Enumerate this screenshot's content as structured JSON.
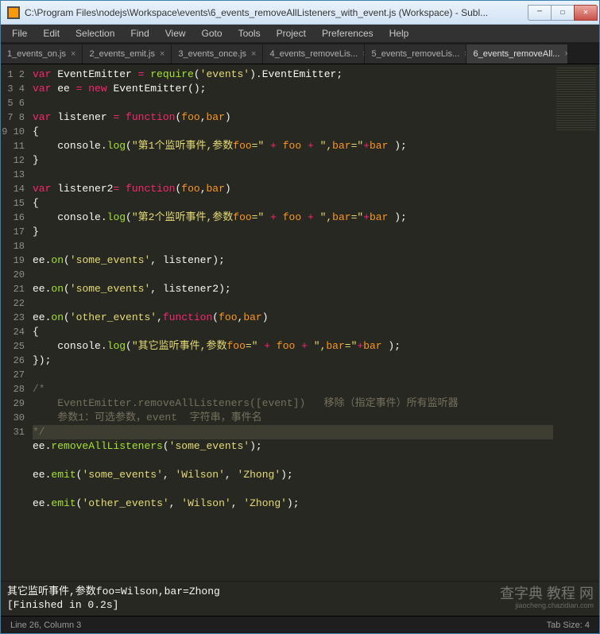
{
  "window": {
    "title": "C:\\Program Files\\nodejs\\Workspace\\events\\6_events_removeAllListeners_with_event.js (Workspace) - Subl..."
  },
  "menu": {
    "items": [
      "File",
      "Edit",
      "Selection",
      "Find",
      "View",
      "Goto",
      "Tools",
      "Project",
      "Preferences",
      "Help"
    ]
  },
  "tabs": [
    {
      "label": "1_events_on.js",
      "active": false
    },
    {
      "label": "2_events_emit.js",
      "active": false
    },
    {
      "label": "3_events_once.js",
      "active": false
    },
    {
      "label": "4_events_removeLis...",
      "active": false
    },
    {
      "label": "5_events_removeLis...",
      "active": false
    },
    {
      "label": "6_events_removeAll...",
      "active": true
    }
  ],
  "code": {
    "lines": [
      {
        "n": 1,
        "t": "var",
        "raw": "var EventEmitter = require('events').EventEmitter;"
      },
      {
        "n": 2,
        "t": "var",
        "raw": "var ee = new EventEmitter();"
      },
      {
        "n": 3,
        "t": "",
        "raw": ""
      },
      {
        "n": 4,
        "t": "var",
        "raw": "var listener = function(foo,bar)"
      },
      {
        "n": 5,
        "t": "",
        "raw": "{"
      },
      {
        "n": 6,
        "t": "",
        "raw": "    console.log(\"第1个监听事件,参数foo=\" + foo + \",bar=\"+bar );"
      },
      {
        "n": 7,
        "t": "",
        "raw": "}"
      },
      {
        "n": 8,
        "t": "",
        "raw": ""
      },
      {
        "n": 9,
        "t": "var",
        "raw": "var listener2= function(foo,bar)"
      },
      {
        "n": 10,
        "t": "",
        "raw": "{"
      },
      {
        "n": 11,
        "t": "",
        "raw": "    console.log(\"第2个监听事件,参数foo=\" + foo + \",bar=\"+bar );"
      },
      {
        "n": 12,
        "t": "",
        "raw": "}"
      },
      {
        "n": 13,
        "t": "",
        "raw": ""
      },
      {
        "n": 14,
        "t": "",
        "raw": "ee.on('some_events', listener);"
      },
      {
        "n": 15,
        "t": "",
        "raw": ""
      },
      {
        "n": 16,
        "t": "",
        "raw": "ee.on('some_events', listener2);"
      },
      {
        "n": 17,
        "t": "",
        "raw": ""
      },
      {
        "n": 18,
        "t": "",
        "raw": "ee.on('other_events',function(foo,bar)"
      },
      {
        "n": 19,
        "t": "",
        "raw": "{"
      },
      {
        "n": 20,
        "t": "",
        "raw": "    console.log(\"其它监听事件,参数foo=\" + foo + \",bar=\"+bar );"
      },
      {
        "n": 21,
        "t": "",
        "raw": "});"
      },
      {
        "n": 22,
        "t": "",
        "raw": ""
      },
      {
        "n": 23,
        "t": "cm",
        "raw": "/*"
      },
      {
        "n": 24,
        "t": "cm",
        "raw": "    EventEmitter.removeAllListeners([event])   移除（指定事件）所有监听器"
      },
      {
        "n": 25,
        "t": "cm",
        "raw": "    参数1：可选参数，event  字符串，事件名"
      },
      {
        "n": 26,
        "t": "cm",
        "raw": "*/",
        "hl": true
      },
      {
        "n": 27,
        "t": "",
        "raw": "ee.removeAllListeners('some_events');"
      },
      {
        "n": 28,
        "t": "",
        "raw": ""
      },
      {
        "n": 29,
        "t": "",
        "raw": "ee.emit('some_events', 'Wilson', 'Zhong');"
      },
      {
        "n": 30,
        "t": "",
        "raw": ""
      },
      {
        "n": 31,
        "t": "",
        "raw": "ee.emit('other_events', 'Wilson', 'Zhong');"
      }
    ]
  },
  "console": {
    "line1": "其它监听事件,参数foo=Wilson,bar=Zhong",
    "line2": "[Finished in 0.2s]"
  },
  "status": {
    "left": "Line 26, Column 3",
    "right": "Tab Size: 4"
  },
  "watermark": {
    "main": "查字典 教程 网",
    "sub": "jiaocheng.chazidian.com"
  }
}
